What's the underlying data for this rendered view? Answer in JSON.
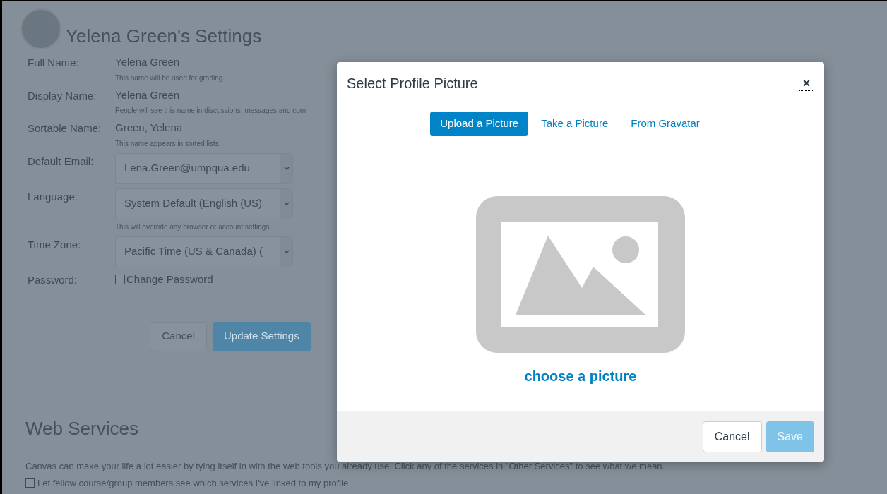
{
  "page": {
    "title": "Yelena Green's Settings",
    "fields": [
      {
        "kind": "text",
        "label": "Full Name:",
        "value": "Yelena Green",
        "hint": "This name will be used for grading."
      },
      {
        "kind": "text",
        "label": "Display Name:",
        "value": "Yelena Green",
        "hint": "People will see this name in discussions, messages and com"
      },
      {
        "kind": "text",
        "label": "Sortable Name:",
        "value": "Green, Yelena",
        "hint": "This name appears in sorted lists."
      },
      {
        "kind": "select",
        "label": "Default Email:",
        "value": "Lena.Green@umpqua.edu"
      },
      {
        "kind": "select",
        "label": "Language:",
        "value": "System Default (English (US)",
        "hint": "This will override any browser or account settings."
      },
      {
        "kind": "select",
        "label": "Time Zone:",
        "value": "Pacific Time (US & Canada) ("
      },
      {
        "kind": "checkbox",
        "label": "Password:",
        "value": "Change Password",
        "checked": false
      }
    ],
    "buttons": [
      "Cancel",
      "Update Settings"
    ],
    "web_services": {
      "title": "Web Services",
      "text": "Canvas can make your life a lot easier by tying itself in with the web tools you already use. Click any of the services in \"Other Services\" to see what we mean.",
      "option": {
        "label": "Let fellow course/group members see which services I've linked to my profile",
        "checked": false
      }
    }
  },
  "dialog": {
    "title": "Select Profile Picture",
    "close": "×",
    "tabs": [
      {
        "label": "Upload a Picture",
        "selected": true
      },
      {
        "label": "Take a Picture",
        "selected": false
      },
      {
        "label": "From Gravatar",
        "selected": false
      }
    ],
    "link": "choose a picture",
    "buttons": [
      {
        "label": "Cancel",
        "kind": "secondary",
        "disabled": false
      },
      {
        "label": "Save",
        "kind": "primary",
        "disabled": true
      }
    ]
  }
}
